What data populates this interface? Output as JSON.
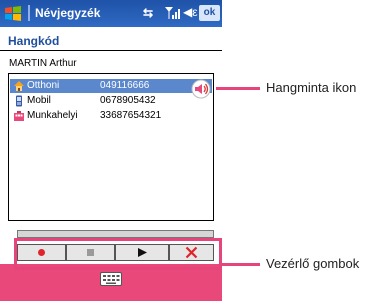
{
  "titlebar": {
    "app_title": "Névjegyzék",
    "ok_label": "ok",
    "icons": [
      "windows-logo-icon",
      "connectivity-icon",
      "signal-icon",
      "volume-icon"
    ]
  },
  "header": {
    "title": "Hangkód"
  },
  "contact": {
    "name": "MARTIN Arthur"
  },
  "phones": [
    {
      "label": "Otthoni",
      "number": "049116666",
      "icon": "home-icon",
      "selected": true
    },
    {
      "label": "Mobil",
      "number": "0678905432",
      "icon": "mobile-icon",
      "selected": false
    },
    {
      "label": "Munkahelyi",
      "number": "33687654321",
      "icon": "work-icon",
      "selected": false
    }
  ],
  "controls": [
    "record-button",
    "stop-button",
    "play-button",
    "delete-button"
  ],
  "callouts": {
    "voice_sample_icon": "Hangminta ikon",
    "control_buttons": "Vezérlő gombok"
  },
  "colors": {
    "titlebar": "#2f6ac4",
    "selection": "#5b87cd",
    "callout": "#e5457a",
    "bottom_bar": "#e8497a"
  }
}
